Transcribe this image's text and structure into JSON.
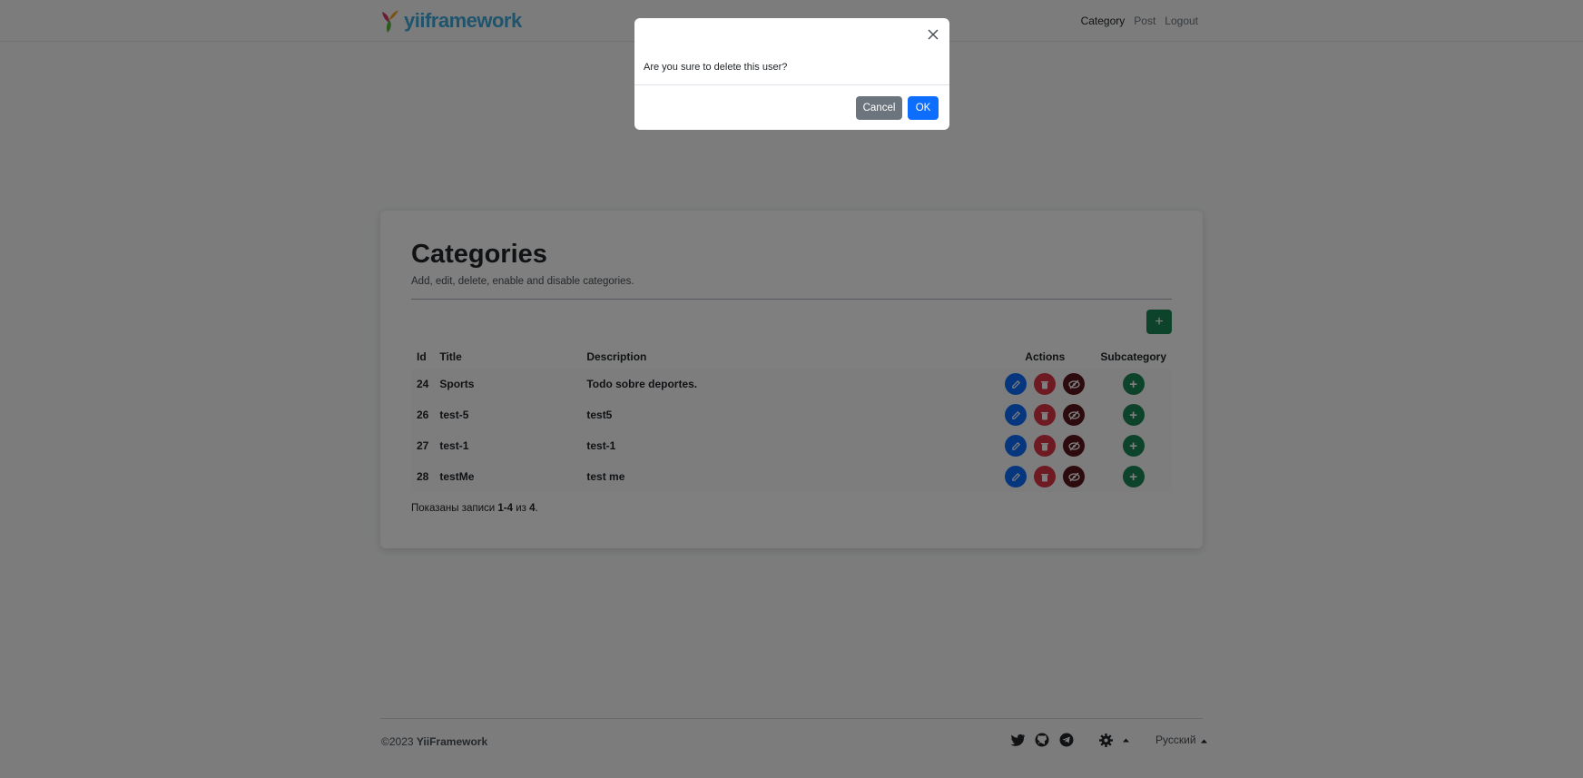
{
  "header": {
    "logo_text": "yiiframework",
    "nav": [
      "Category",
      "Post",
      "Logout"
    ]
  },
  "main": {
    "title": "Categories",
    "subtitle": "Add, edit, delete, enable and disable categories.",
    "add_button": "+",
    "table": {
      "columns": [
        "Id",
        "Title",
        "Description",
        "Actions",
        "Subcategory"
      ],
      "rows": [
        {
          "id": "24",
          "title": "Sports",
          "description": "Todo sobre deportes."
        },
        {
          "id": "26",
          "title": "test-5",
          "description": "test5"
        },
        {
          "id": "27",
          "title": "test-1",
          "description": "test-1"
        },
        {
          "id": "28",
          "title": "testMe",
          "description": "test me"
        }
      ]
    },
    "summary": {
      "prefix": "Показаны записи ",
      "range": "1-4",
      "mid": " из ",
      "total": "4",
      "suffix": "."
    }
  },
  "footer": {
    "copyright_prefix": "©2023 ",
    "copyright_brand": "YiiFramework",
    "language": "Русский"
  },
  "modal": {
    "message": "Are you sure to delete this user?",
    "cancel_label": "Cancel",
    "ok_label": "OK"
  },
  "colors": {
    "primary": "#0d6efd",
    "danger": "#dc3545",
    "success": "#198754",
    "secondary": "#6c757d"
  },
  "icons": [
    "yii-logo-icon",
    "edit-icon",
    "trash-icon",
    "eye-slash-icon",
    "plus-icon",
    "close-icon",
    "twitter-icon",
    "github-icon",
    "telegram-icon",
    "theme-gear-icon",
    "caret-down-icon"
  ]
}
